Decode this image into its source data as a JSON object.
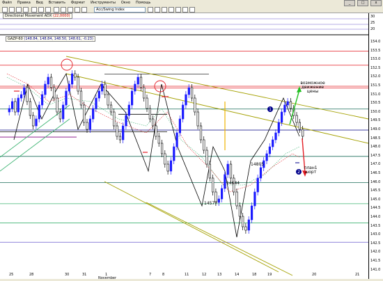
{
  "menubar": {
    "items": [
      "Файл",
      "Правка",
      "Вид",
      "Вставить",
      "Формат",
      "Инструменты",
      "Окно",
      "Помощь"
    ],
    "window_buttons": [
      "_",
      "□",
      "x"
    ]
  },
  "toolbar": {
    "symbol_value": "Acc/Swing Index"
  },
  "indicator": {
    "label": "Directional Movement ADX",
    "value": "(22,0000)",
    "y_labels": [
      "30",
      "25",
      "20"
    ]
  },
  "main": {
    "label": "GAZP-60",
    "ohlc": "(148.84, 148.84, 148.50, 148.61, -0.23)",
    "y_labels": [
      "154.0",
      "153.5",
      "153.0",
      "152.5",
      "152.0",
      "151.5",
      "151.0",
      "150.5",
      "150.0",
      "149.5",
      "149.0",
      "148.5",
      "148.0",
      "147.5",
      "147.0",
      "146.5",
      "146.0",
      "145.5",
      "145.0",
      "144.5",
      "144.0",
      "143.5",
      "143.0",
      "142.5",
      "142.0",
      "141.5",
      "141.0"
    ],
    "price_marks": [
      "14805",
      "14644",
      "14577"
    ],
    "annotation_move": "возможное движение цены",
    "annotation_plan": "план1 шорт",
    "badges": [
      "1",
      "2"
    ]
  },
  "xaxis": {
    "ticks": [
      "25",
      "28",
      "30",
      "31",
      "1",
      "7",
      "8",
      "11",
      "12",
      "13",
      "14",
      "18",
      "19",
      "20",
      "21"
    ],
    "month": "November"
  },
  "colors": {
    "up_candle": "#1a1aff",
    "down_candle": "#000000",
    "red_level": "#e31b23",
    "green_channel": "#3cb371",
    "olive_channel": "#a4a000",
    "orange_mark": "#f0b400"
  }
}
